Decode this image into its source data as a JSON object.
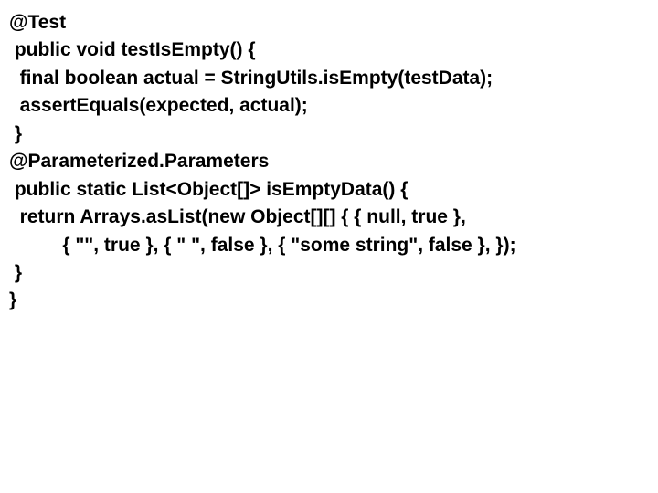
{
  "code": {
    "l1": "@Test",
    "l2": " public void testIsEmpty() {",
    "l3": "  final boolean actual = StringUtils.isEmpty(testData);",
    "l4": "  assertEquals(expected, actual);",
    "l5": " }",
    "l6": "@Parameterized.Parameters",
    "l7": " public static List<Object[]> isEmptyData() {",
    "l8": "  return Arrays.asList(new Object[][] { { null, true },",
    "l9": "          { \"\", true }, { \" \", false }, { \"some string\", false }, });",
    "l10": " }",
    "l11": "}"
  }
}
